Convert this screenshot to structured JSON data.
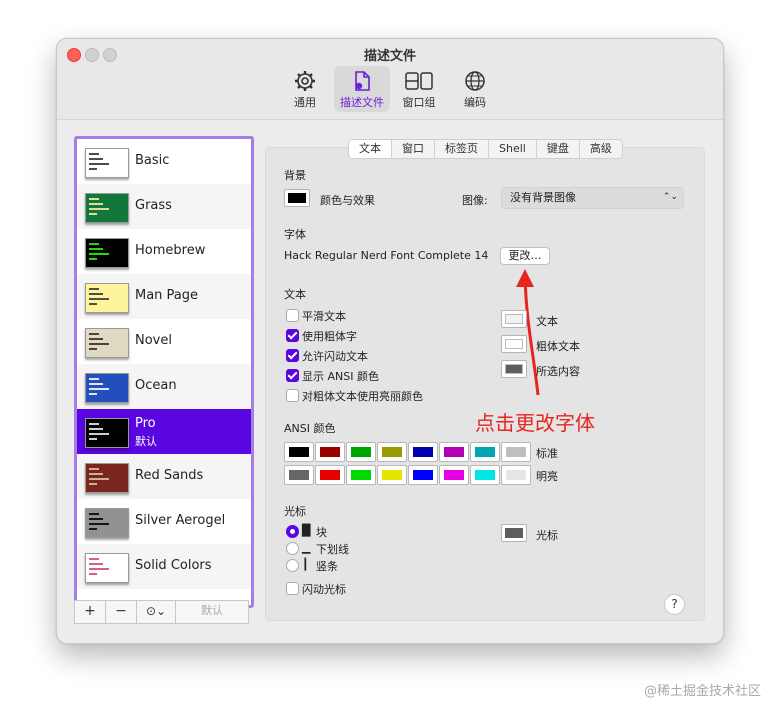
{
  "window": {
    "title": "描述文件"
  },
  "toolbar": [
    {
      "label": "通用",
      "icon": "gear-icon"
    },
    {
      "label": "描述文件",
      "icon": "profile-doc-icon"
    },
    {
      "label": "窗口组",
      "icon": "window-group-icon"
    },
    {
      "label": "编码",
      "icon": "globe-icon"
    }
  ],
  "profiles": [
    {
      "name": "Basic",
      "thumb": "#ffffff",
      "bars": "#2c2c2c"
    },
    {
      "name": "Grass",
      "thumb": "#13773d",
      "bars": "#fff0a5"
    },
    {
      "name": "Homebrew",
      "thumb": "#000000",
      "bars": "#28fe14"
    },
    {
      "name": "Man Page",
      "thumb": "#fef49c",
      "bars": "#333333"
    },
    {
      "name": "Novel",
      "thumb": "#dfdbc3",
      "bars": "#3b2322"
    },
    {
      "name": "Ocean",
      "thumb": "#224fbc",
      "bars": "#ffffff"
    },
    {
      "name": "Pro",
      "sub": "默认",
      "thumb": "#000000",
      "bars": "#f2f2f2"
    },
    {
      "name": "Red Sands",
      "thumb": "#7a251e",
      "bars": "#d7c9a7"
    },
    {
      "name": "Silver Aerogel",
      "thumb": "#929292",
      "bars": "#000000"
    },
    {
      "name": "Solid Colors",
      "thumb": "#ffffff",
      "bars": "#d0446a"
    }
  ],
  "sidebar_buttons": {
    "add": "+",
    "remove": "−",
    "more": "⊙⌄",
    "default": "默认"
  },
  "tabs": [
    "文本",
    "窗口",
    "标签页",
    "Shell",
    "键盘",
    "高级"
  ],
  "background": {
    "heading": "背景",
    "color_effects": "颜色与效果",
    "image_label": "图像:",
    "image_value": "没有背景图像"
  },
  "font": {
    "heading": "字体",
    "value": "Hack Regular Nerd Font Complete 14",
    "change_button": "更改…"
  },
  "text": {
    "heading": "文本",
    "options": [
      {
        "label": "平滑文本",
        "checked": false
      },
      {
        "label": "使用粗体字",
        "checked": true
      },
      {
        "label": "允许闪动文本",
        "checked": true
      },
      {
        "label": "显示 ANSI 颜色",
        "checked": true
      },
      {
        "label": "对粗体文本使用亮丽颜色",
        "checked": false
      }
    ],
    "colors": [
      {
        "label": "文本",
        "color": "#f2f2f2"
      },
      {
        "label": "粗体文本",
        "color": "#ffffff"
      },
      {
        "label": "所选内容",
        "color": "#5e5e5e"
      }
    ]
  },
  "ansi": {
    "heading": "ANSI 颜色",
    "normal_label": "标准",
    "bright_label": "明亮",
    "normal": [
      "#000000",
      "#990000",
      "#00a600",
      "#999900",
      "#0000b2",
      "#b200b2",
      "#00a6b2",
      "#bfbfbf"
    ],
    "bright": [
      "#666666",
      "#e50000",
      "#00d900",
      "#e5e500",
      "#0000ff",
      "#e500e5",
      "#00e5e5",
      "#e5e5e5"
    ]
  },
  "cursor": {
    "heading": "光标",
    "styles": [
      {
        "glyph": "█",
        "label": "块",
        "selected": true
      },
      {
        "glyph": "▁",
        "label": "下划线",
        "selected": false
      },
      {
        "glyph": "┃",
        "label": "竖条",
        "selected": false
      }
    ],
    "blink_label": "闪动光标",
    "blink": false,
    "color_label": "光标",
    "color": "#5e5e5e"
  },
  "help": "?",
  "annotation": "点击更改字体",
  "watermark": "@稀土掘金技术社区"
}
